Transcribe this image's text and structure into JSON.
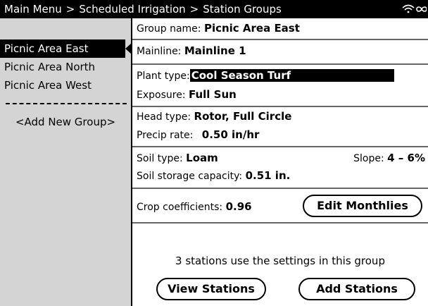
{
  "titlebar": {
    "crumbs": [
      "Main Menu",
      "Scheduled Irrigation",
      "Station Groups"
    ],
    "separator": ">",
    "icons": [
      "wifi-icon",
      "infinity-icon"
    ]
  },
  "sidebar": {
    "groups": [
      "Picnic Area East",
      "Picnic Area North",
      "Picnic Area West"
    ],
    "selected_index": 0,
    "add_label": "<Add New Group>"
  },
  "details": {
    "group_name_label": "Group name:",
    "group_name": "Picnic Area East",
    "mainline_label": "Mainline:",
    "mainline": "Mainline 1",
    "plant_type_label": "Plant type:",
    "plant_type": "Cool Season Turf",
    "exposure_label": "Exposure:",
    "exposure": "Full Sun",
    "head_type_label": "Head type:",
    "head_type": "Rotor, Full Circle",
    "precip_label": "Precip rate:",
    "precip": "0.50 in/hr",
    "soil_type_label": "Soil type:",
    "soil_type": "Loam",
    "slope_label": "Slope:",
    "slope": "4 – 6%",
    "storage_label": "Soil storage capacity:",
    "storage": "0.51 in.",
    "crop_label": "Crop coefficients:",
    "crop": "0.96",
    "edit_monthlies": "Edit Monthlies",
    "stations_note": "3 stations use the settings in this group",
    "view_stations": "View Stations",
    "add_stations": "Add Stations"
  }
}
